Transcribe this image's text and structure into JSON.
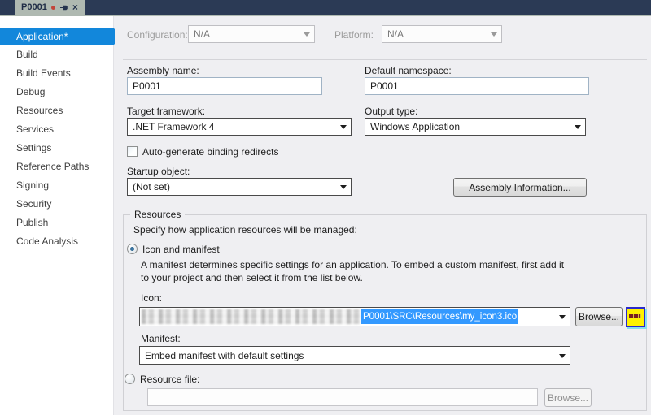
{
  "tab": {
    "title": "P0001",
    "close_glyph": "×"
  },
  "sidebar": {
    "items": [
      {
        "label": "Application*",
        "selected": true
      },
      {
        "label": "Build",
        "selected": false
      },
      {
        "label": "Build Events",
        "selected": false
      },
      {
        "label": "Debug",
        "selected": false
      },
      {
        "label": "Resources",
        "selected": false
      },
      {
        "label": "Services",
        "selected": false
      },
      {
        "label": "Settings",
        "selected": false
      },
      {
        "label": "Reference Paths",
        "selected": false
      },
      {
        "label": "Signing",
        "selected": false
      },
      {
        "label": "Security",
        "selected": false
      },
      {
        "label": "Publish",
        "selected": false
      },
      {
        "label": "Code Analysis",
        "selected": false
      }
    ]
  },
  "toolbar": {
    "configuration_label": "Configuration:",
    "configuration_value": "N/A",
    "platform_label": "Platform:",
    "platform_value": "N/A"
  },
  "form": {
    "assembly_name_label": "Assembly name:",
    "assembly_name_value": "P0001",
    "default_namespace_label": "Default namespace:",
    "default_namespace_value": "P0001",
    "target_framework_label": "Target framework:",
    "target_framework_value": ".NET Framework 4",
    "output_type_label": "Output type:",
    "output_type_value": "Windows Application",
    "autogen_checkbox_label": "Auto-generate binding redirects",
    "startup_object_label": "Startup object:",
    "startup_object_value": "(Not set)",
    "assembly_info_button": "Assembly Information..."
  },
  "resources": {
    "group_title": "Resources",
    "intro": "Specify how application resources will be managed:",
    "icon_manifest_radio": "Icon and manifest",
    "manifest_description": "A manifest determines specific settings for an application. To embed a custom manifest, first add it to your project and then select it from the list below.",
    "icon_label": "Icon:",
    "icon_path_selected": "P0001\\SRC\\Resources\\my_icon3.ico",
    "browse_button": "Browse...",
    "manifest_label": "Manifest:",
    "manifest_value": "Embed manifest with default settings",
    "resource_file_radio": "Resource file:",
    "resource_file_value": "",
    "browse_button_disabled": "Browse..."
  },
  "colors": {
    "accent": "#1287DB",
    "tab-strip": "#2B3A55",
    "tab-bg": "#AFB9B1",
    "selection": "#3399FF",
    "icon-yellow": "#FFF200",
    "icon-blue": "#2A2ACC",
    "icon-cyan": "#86DEEF",
    "modified-red": "#C2453A"
  }
}
